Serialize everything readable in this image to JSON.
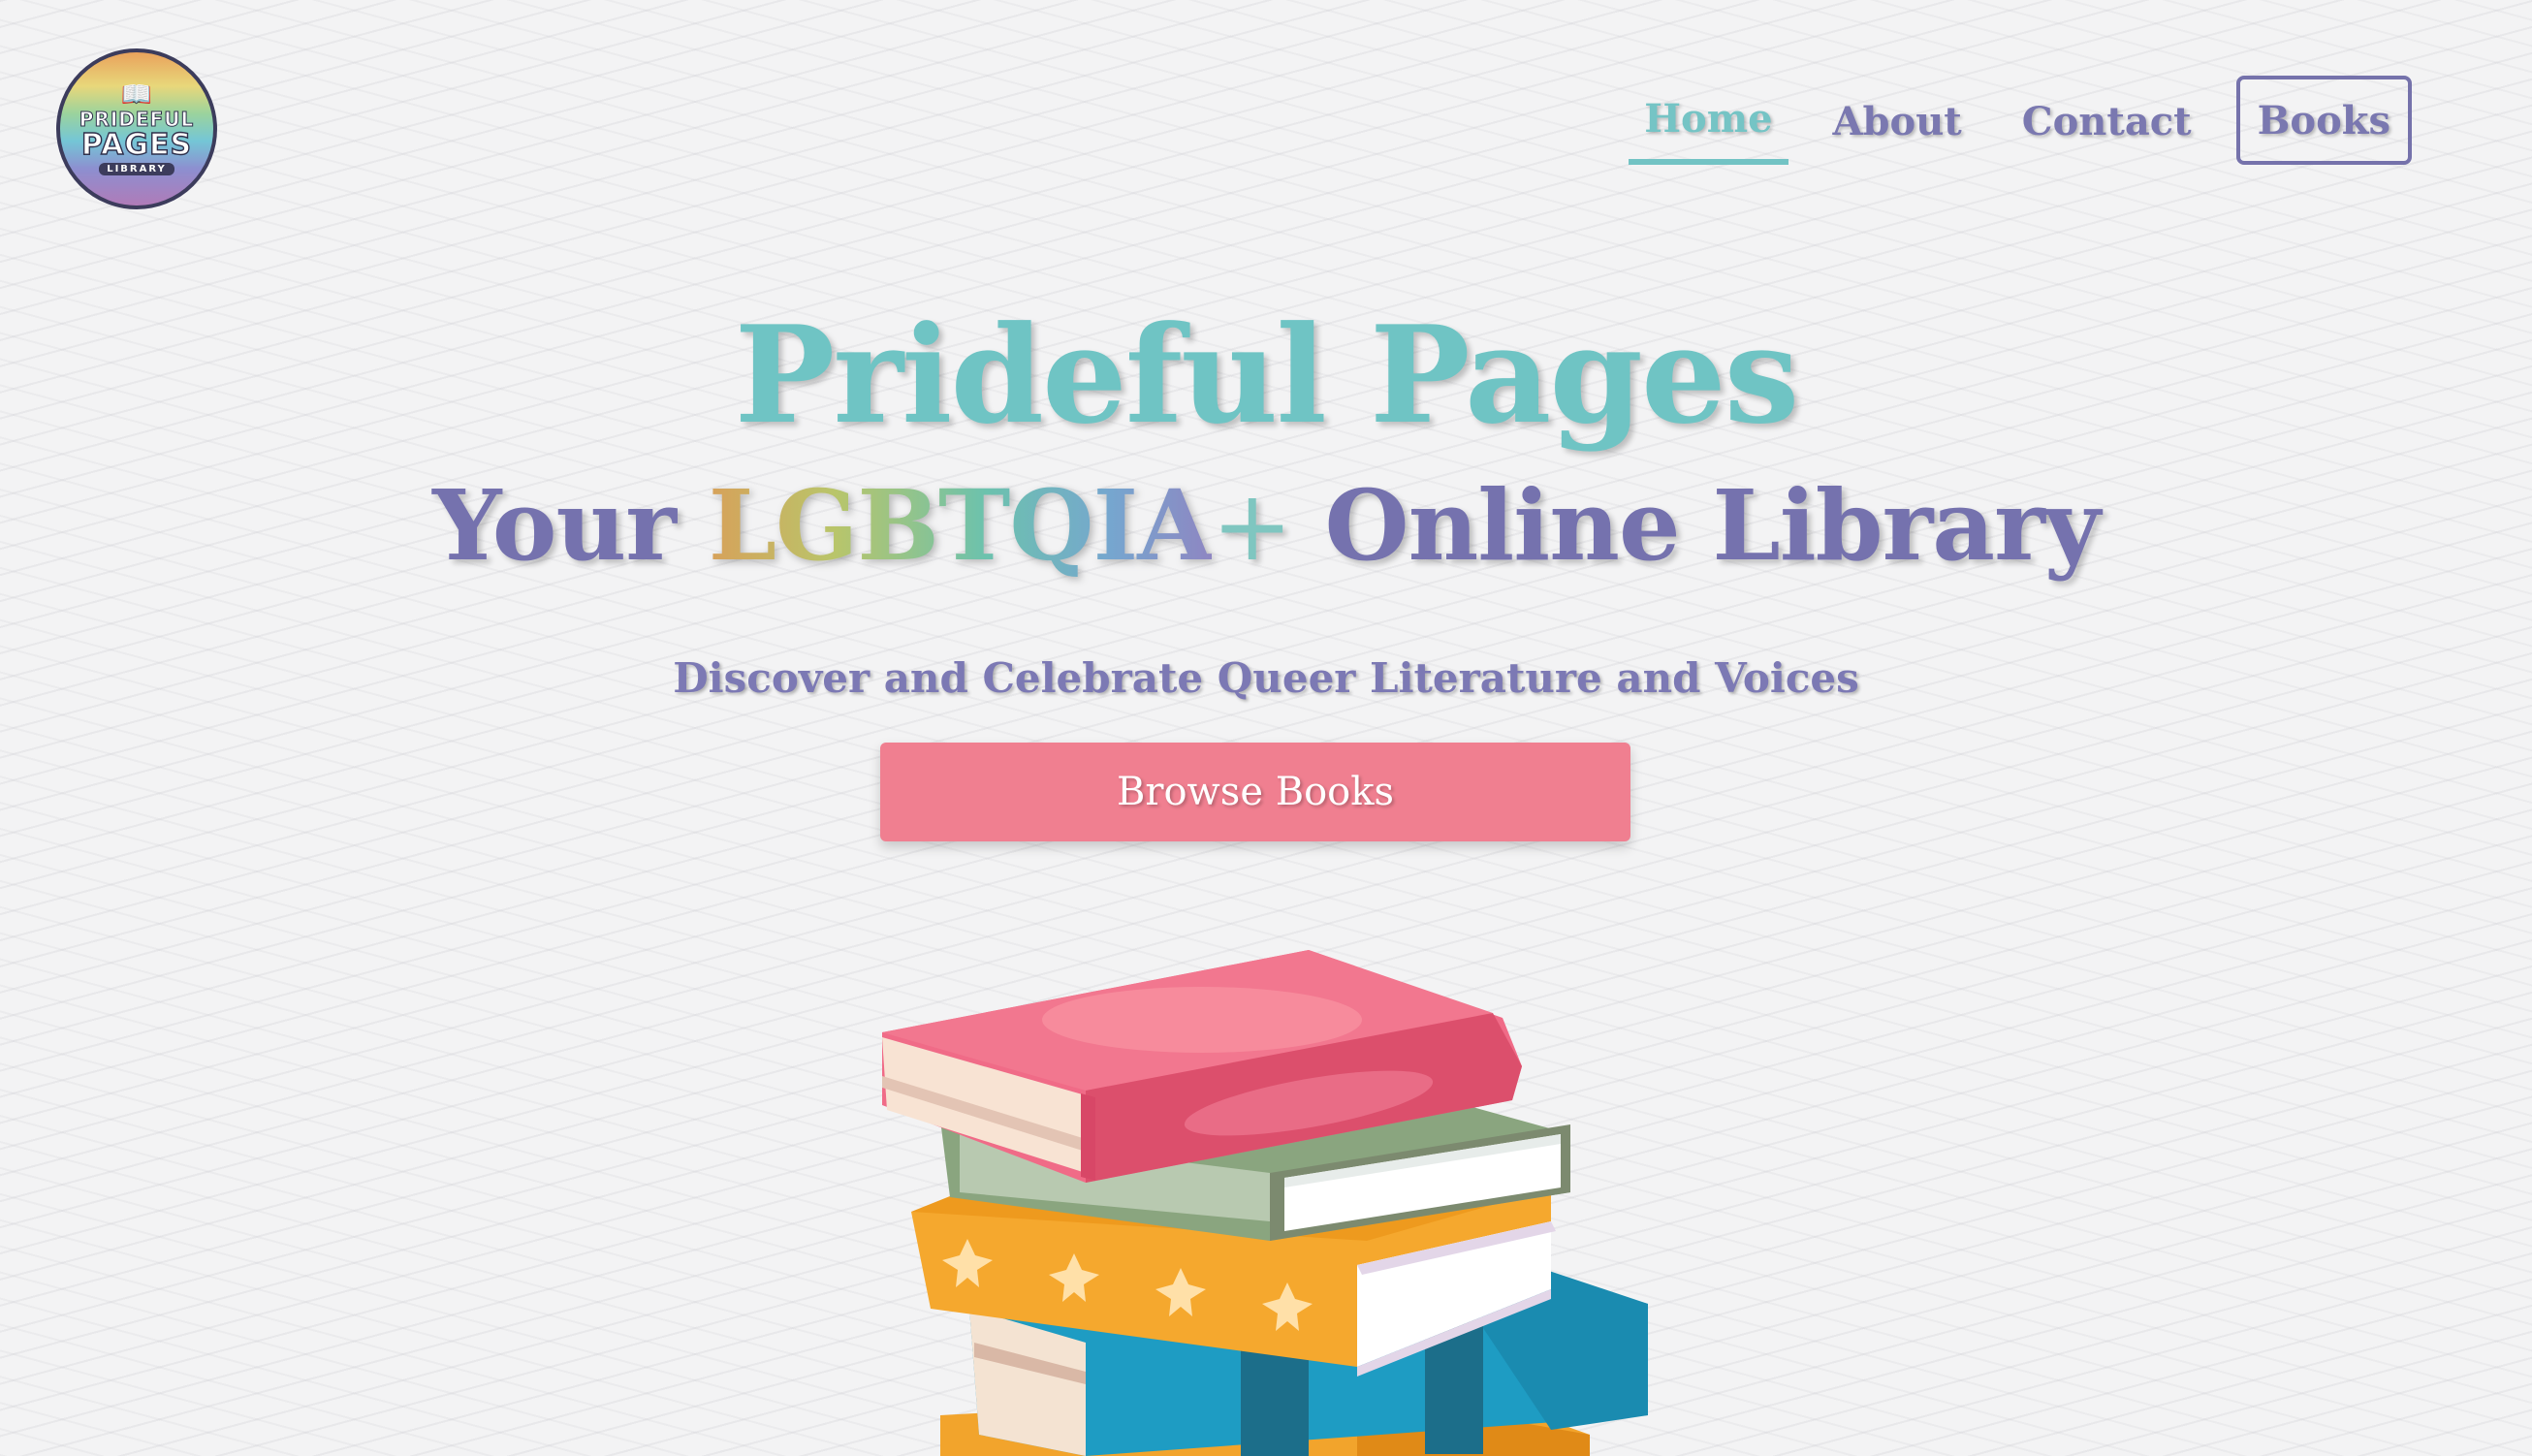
{
  "logo": {
    "line1": "PRIDEFUL",
    "line2": "PAGES",
    "line3": "LIBRARY",
    "icon": "open-book-icon"
  },
  "nav": {
    "items": [
      {
        "label": "Home",
        "active": true
      },
      {
        "label": "About"
      },
      {
        "label": "Contact"
      },
      {
        "label": "Books",
        "boxed": true
      }
    ]
  },
  "hero": {
    "title": "Prideful Pages",
    "subtitle_prefix": "Your ",
    "subtitle_highlight": "LGBTQIA",
    "subtitle_plus": "+",
    "subtitle_suffix": " Online Library",
    "tagline": "Discover and Celebrate Queer Literature and Voices",
    "cta_label": "Browse Books"
  },
  "illustration": {
    "name": "stack-of-books-icon"
  },
  "colors": {
    "teal": "#6fc4c4",
    "purple": "#7572ae",
    "pink": "#f07f90",
    "background": "#f3f3f4"
  }
}
